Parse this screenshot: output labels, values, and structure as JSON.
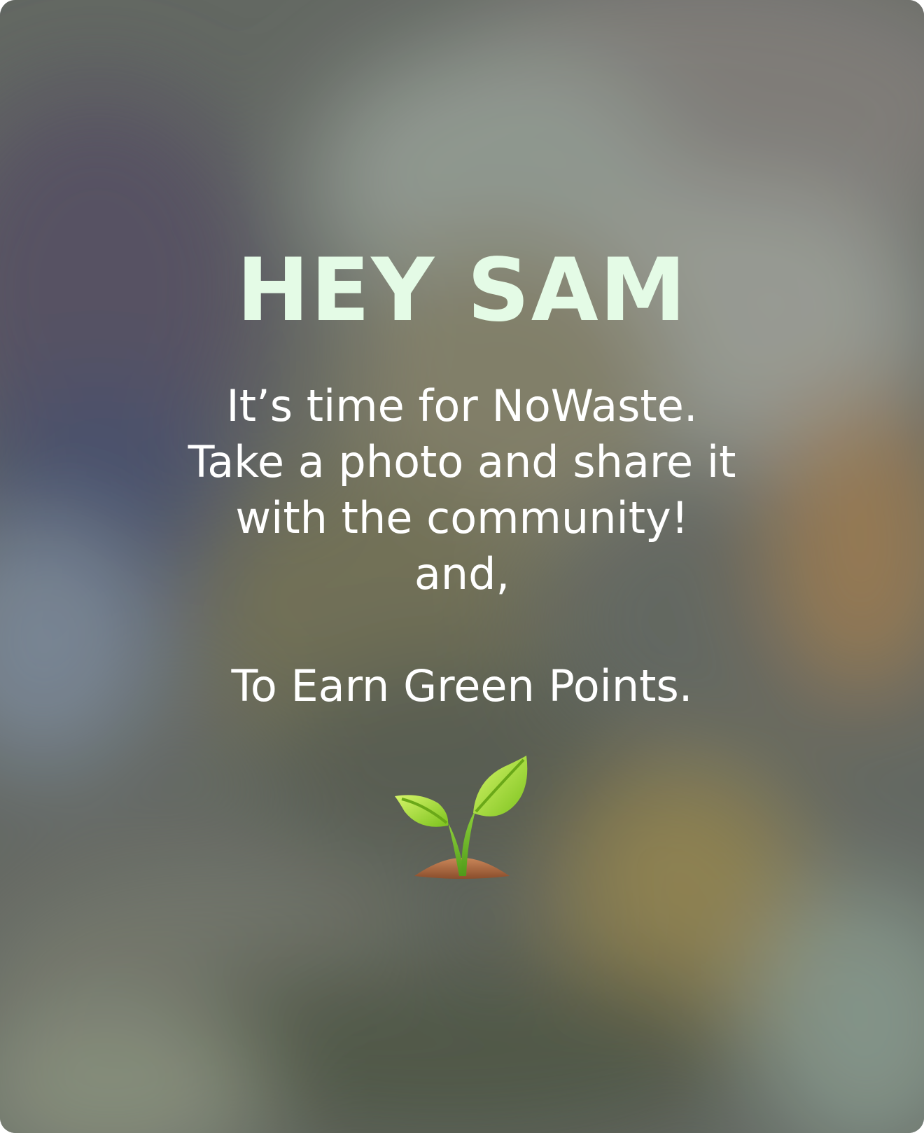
{
  "headline": "HEY SAM",
  "message": {
    "line1": "It’s time for NoWaste.",
    "line2": "Take a photo and share it",
    "line3": "with the community!",
    "line4": "and,",
    "line5": "To Earn Green Points."
  },
  "icon": "seedling-icon",
  "colors": {
    "headline": "#e4fbe6",
    "message": "#ffffff",
    "leaf": "#9fdc2f",
    "soil": "#a7623a"
  }
}
